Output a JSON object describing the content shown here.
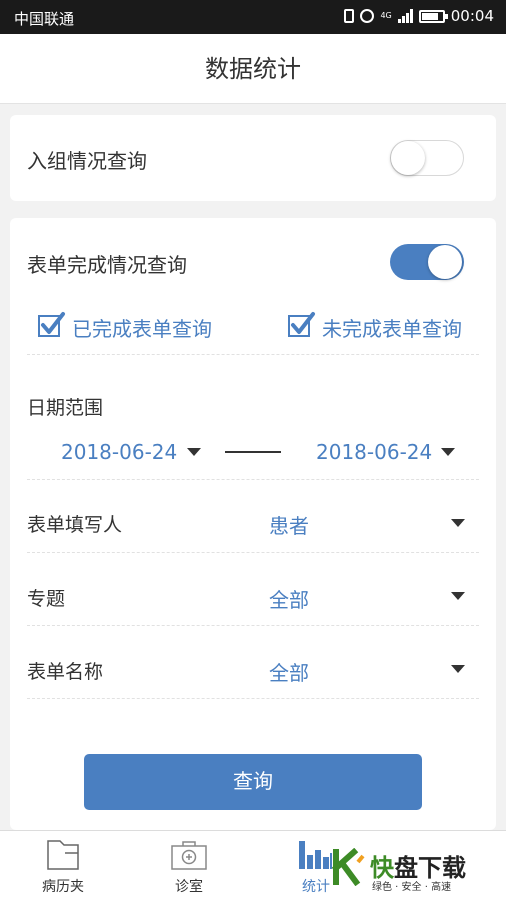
{
  "status_bar": {
    "carrier": "中国联通",
    "network": "4G",
    "time": "00:04"
  },
  "header": {
    "title": "数据统计"
  },
  "enrollment_query": {
    "label": "入组情况查询",
    "enabled": false
  },
  "form_completion_query": {
    "label": "表单完成情况查询",
    "enabled": true,
    "completed_check": {
      "label": "已完成表单查询",
      "checked": true
    },
    "incomplete_check": {
      "label": "未完成表单查询",
      "checked": true
    },
    "date_range_label": "日期范围",
    "start_date": "2018-06-24",
    "end_date": "2018-06-24",
    "filler_label": "表单填写人",
    "filler_value": "患者",
    "topic_label": "专题",
    "topic_value": "全部",
    "form_name_label": "表单名称",
    "form_name_value": "全部",
    "query_button": "查询"
  },
  "tabbar": {
    "tabs": [
      {
        "label": "病历夹",
        "icon": "folder-icon"
      },
      {
        "label": "诊室",
        "icon": "medical-kit-icon"
      },
      {
        "label": "统计",
        "icon": "bar-chart-icon",
        "active": true
      }
    ]
  },
  "watermark": {
    "main_green": "快",
    "main_dark": "盘下载",
    "sub": "绿色 · 安全 · 高速"
  },
  "colors": {
    "accent": "#4a7fc1",
    "status_bar": "#1a1a1a",
    "background": "#f2f2f2"
  }
}
